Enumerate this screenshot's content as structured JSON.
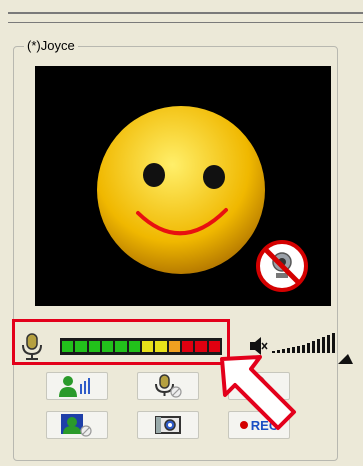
{
  "panel": {
    "title": "(*)Joyce"
  },
  "audio": {
    "level_segments": 12,
    "level_active": 12
  },
  "buttons": [
    {
      "name": "talk-button",
      "icon": "user-speaking-icon"
    },
    {
      "name": "mic-button",
      "icon": "microphone-mute-icon"
    },
    {
      "name": "webcam-button",
      "icon": "webcam-mute-icon"
    },
    {
      "name": "video-button",
      "icon": "user-video-icon"
    },
    {
      "name": "snapshot-button",
      "icon": "camera-icon"
    },
    {
      "name": "record-button",
      "icon": "record-dot-icon",
      "label": "REC"
    }
  ],
  "colors": {
    "highlight": "#e3001b",
    "meter_green": "#22c21b",
    "meter_yellow": "#e8e21a",
    "meter_red": "#e00010"
  }
}
